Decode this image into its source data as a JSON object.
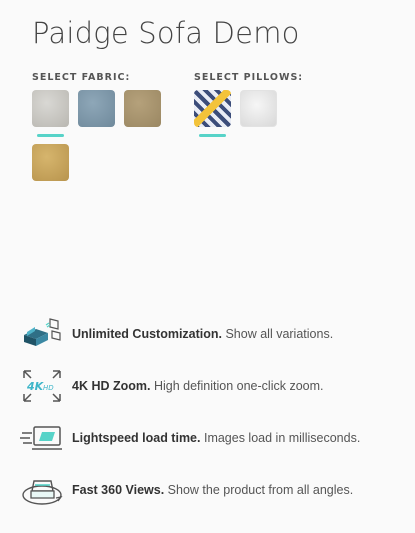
{
  "title": "Paidge Sofa Demo",
  "fabric": {
    "label": "SELECT FABRIC:",
    "swatches": [
      {
        "name": "grey",
        "selected": true,
        "color": "#c9c7c2"
      },
      {
        "name": "blue",
        "selected": false,
        "color": "#7f98aa"
      },
      {
        "name": "tan",
        "selected": false,
        "color": "#a8946f"
      },
      {
        "name": "gold",
        "selected": false,
        "color": "#c9a55d"
      }
    ]
  },
  "pillows": {
    "label": "SELECT PILLOWS:",
    "swatches": [
      {
        "name": "pattern",
        "selected": true,
        "color": "#3c4d7a"
      },
      {
        "name": "white",
        "selected": false,
        "color": "#e8e8e8"
      }
    ]
  },
  "accent_color": "#57d3c8",
  "features": [
    {
      "icon": "sofa-customization-icon",
      "title": "Unlimited Customization.",
      "desc": " Show all variations."
    },
    {
      "icon": "4k-zoom-icon",
      "title": "4K HD Zoom.",
      "desc": " High definition one-click zoom."
    },
    {
      "icon": "lightspeed-icon",
      "title": "Lightspeed load time.",
      "desc": " Images load in milliseconds."
    },
    {
      "icon": "360-view-icon",
      "title": "Fast 360 Views.",
      "desc": " Show the product from all angles."
    }
  ]
}
